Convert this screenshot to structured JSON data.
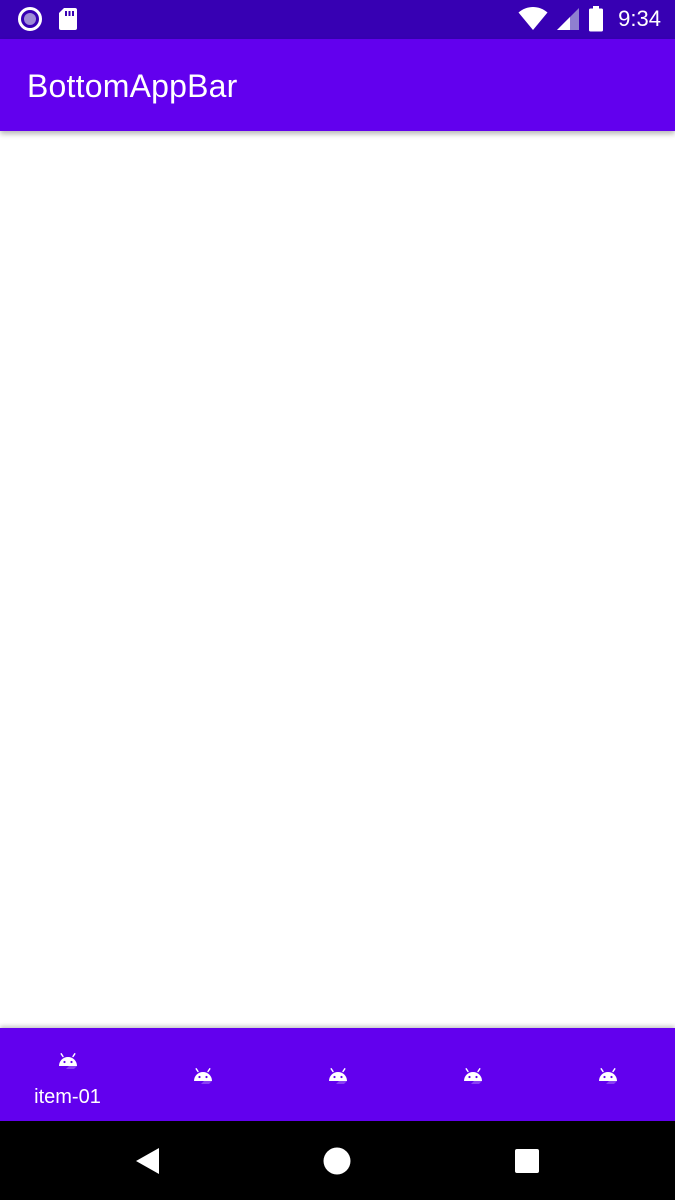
{
  "status_bar": {
    "time": "9:34",
    "icons": [
      "record-icon",
      "sd-card-icon",
      "wifi-icon",
      "signal-icon",
      "battery-icon"
    ]
  },
  "app_bar": {
    "title": "BottomAppBar"
  },
  "bottom_nav": {
    "items": [
      {
        "label": "item-01",
        "icon": "android-icon",
        "active": true
      },
      {
        "label": "",
        "icon": "android-icon",
        "active": false
      },
      {
        "label": "",
        "icon": "android-icon",
        "active": false
      },
      {
        "label": "",
        "icon": "android-icon",
        "active": false
      },
      {
        "label": "",
        "icon": "android-icon",
        "active": false
      }
    ]
  },
  "system_nav": {
    "buttons": [
      "back-icon",
      "home-icon",
      "recents-icon"
    ]
  },
  "colors": {
    "status_bar": "#3700b3",
    "primary": "#6200ee",
    "on_primary": "#ffffff",
    "system_nav": "#000000"
  }
}
